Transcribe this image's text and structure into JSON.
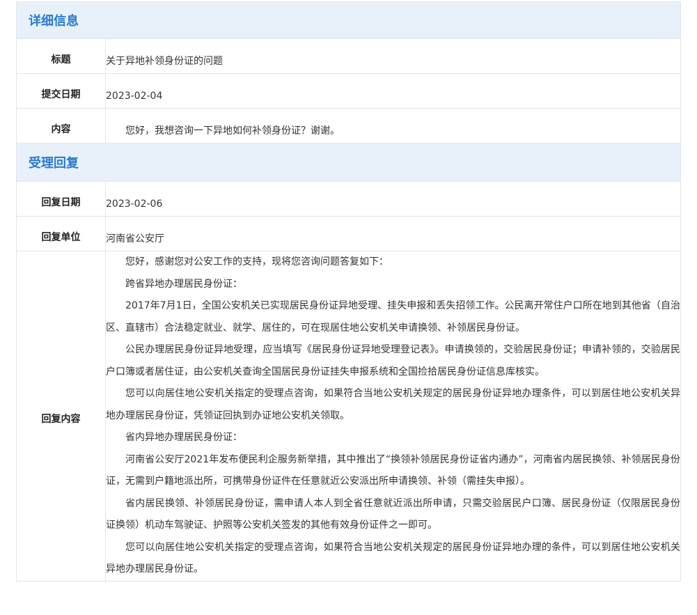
{
  "detail_section": {
    "title": "详细信息",
    "rows": {
      "title_label": "标题",
      "title_value": "关于异地补领身份证的问题",
      "date_label": "提交日期",
      "date_value": "2023-02-04",
      "content_label": "内容",
      "content_value": "您好，我想咨询一下异地如何补领身份证？谢谢。"
    }
  },
  "reply_section": {
    "title": "受理回复",
    "rows": {
      "date_label": "回复日期",
      "date_value": "2023-02-06",
      "unit_label": "回复单位",
      "unit_value": "河南省公安厅",
      "content_label": "回复内容"
    },
    "paragraphs": [
      "您好，感谢您对公安工作的支持，现将您咨询问题答复如下：",
      "跨省异地办理居民身份证：",
      "2017年7月1日，全国公安机关已实现居民身份证异地受理、挂失申报和丢失招领工作。公民离开常住户口所在地到其他省（自治区、直辖市）合法稳定就业、就学、居住的，可在现居住地公安机关申请换领、补领居民身份证。",
      "公民办理居民身份证异地受理，应当填写《居民身份证异地受理登记表》。申请换领的，交验居民身份证；申请补领的，交验居民户口簿或者居住证，由公安机关查询全国居民身份证挂失申报系统和全国捡拾居民身份证信息库核实。",
      "您可以向居住地公安机关指定的受理点咨询，如果符合当地公安机关规定的居民身份证异地办理条件，可以到居住地公安机关异地办理居民身份证，凭领证回执到办证地公安机关领取。",
      "省内异地办理居民身份证：",
      "河南省公安厅2021年发布便民利企服务新举措，其中推出了“换领补领居民身份证省内通办”，河南省内居民换领、补领居民身份证，无需到户籍地派出所，可携带身份证件在任意就近公安派出所申请换领、补领（需挂失申报）。",
      "省内居民换领、补领居民身份证，需申请人本人到全省任意就近派出所申请，只需交验居民户口簿、居民身份证（仅限居民身份证换领）机动车驾驶证、护照等公安机关签发的其他有效身份证件之一即可。",
      "您可以向居住地公安机关指定的受理点咨询，如果符合当地公安机关规定的居民身份证异地办理的条件，可以到居住地公安机关异地办理居民身份证。"
    ]
  }
}
